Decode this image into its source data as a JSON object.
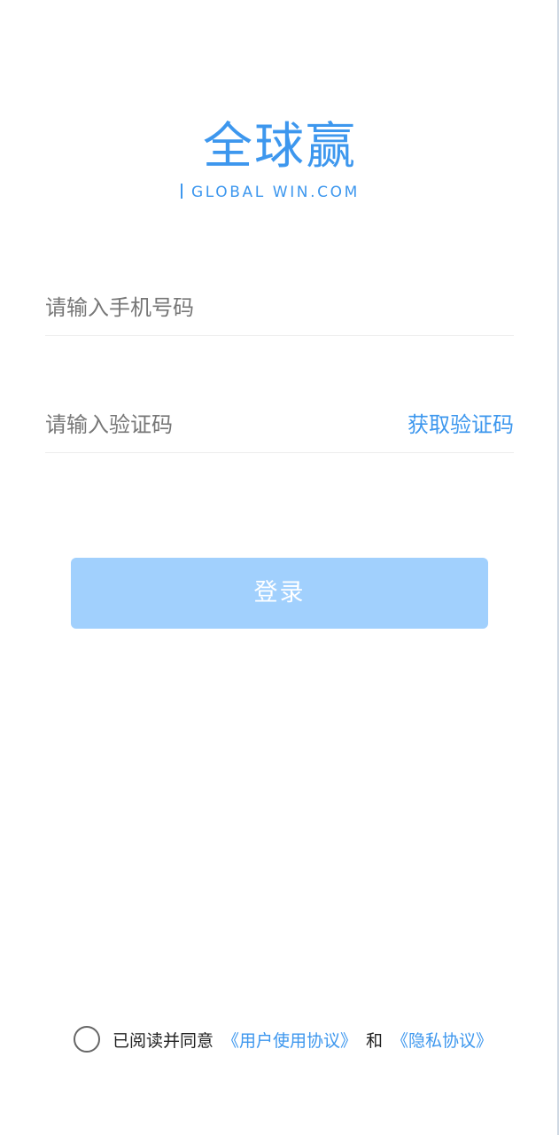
{
  "logo": {
    "title": "全球赢",
    "subtitle": "GLOBAL WIN.COM"
  },
  "form": {
    "phone_placeholder": "请输入手机号码",
    "code_placeholder": "请输入验证码",
    "get_code_label": "获取验证码",
    "login_label": "登录"
  },
  "agreement": {
    "prefix": "已阅读并同意",
    "user_agreement": "《用户使用协议》",
    "and": "和",
    "privacy_agreement": "《隐私协议》"
  },
  "colors": {
    "accent": "#3d97ee",
    "button_disabled": "#a1d0fd"
  }
}
